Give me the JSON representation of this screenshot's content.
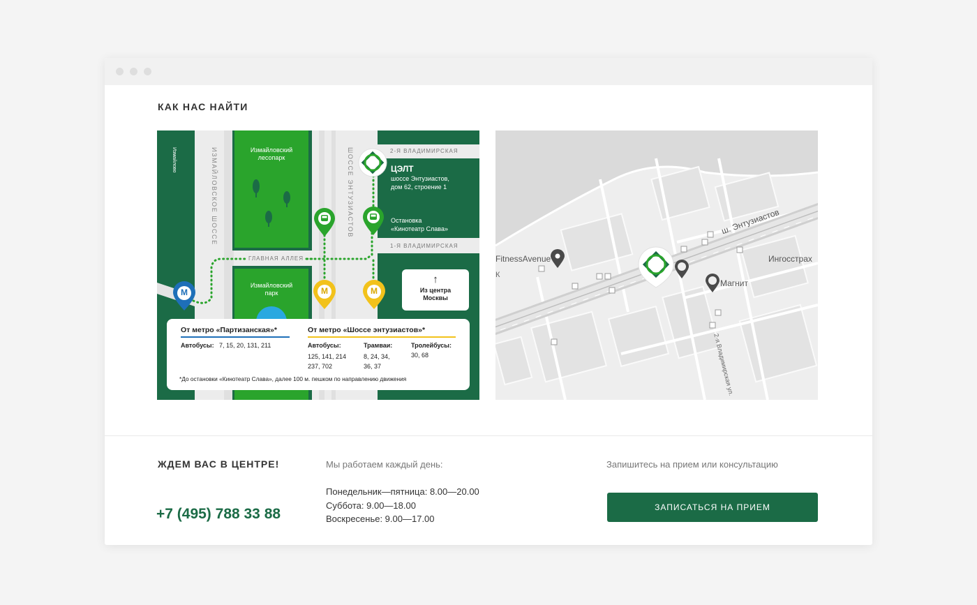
{
  "section": {
    "title": "КАК НАС НАЙТИ"
  },
  "scheme": {
    "street_izmailovo": "Измайлово",
    "street_izm_shosse": "ИЗМАЙЛОВСКОЕ ШОССЕ",
    "street_entuziastov": "ШОССЕ ЭНТУЗИАСТОВ",
    "street_vladimir2": "2-Я ВЛАДИМИРСКАЯ",
    "street_vladimir1": "1-Я ВЛАДИМИРСКАЯ",
    "street_main_alley": "ГЛАВНАЯ АЛЛЕЯ",
    "forest_park_1": "Измайловский",
    "forest_park_2": "лесопарк",
    "park_1": "Измайловский",
    "park_2": "парк",
    "center_name": "ЦЭЛТ",
    "center_addr_1": "шоссе Энтузиастов,",
    "center_addr_2": "дом 62, строение 1",
    "stop_1": "Остановка",
    "stop_2": "«Кинотеатр Слава»",
    "from_center_1": "Из центра",
    "from_center_2": "Москвы",
    "metro_glyph": "М",
    "arrow_glyph": "↑",
    "route1_title": "От метро «Партизанская»*",
    "route1_bus_label": "Автобусы:",
    "route1_bus_values": "7, 15, 20, 131, 211",
    "route2_title": "От метро «Шоссе энтузиастов»*",
    "route2_bus_label": "Автобусы:",
    "route2_bus_line1": "125, 141, 214",
    "route2_bus_line2": "237, 702",
    "route2_tram_label": "Трамваи:",
    "route2_tram_line1": "8, 24, 34,",
    "route2_tram_line2": "36, 37",
    "route2_trolley_label": "Тролейбусы:",
    "route2_trolley_values": "30, 68",
    "footnote": "*До остановки «Кинотеатр Слава», далее 100 м. пешком по направлению движения",
    "colors": {
      "dark_green": "#1b6b46",
      "grass": "#2aa42c",
      "metro_blue": "#1e6fb8",
      "metro_yellow": "#f2c21b"
    }
  },
  "gmap": {
    "label_fitness": "FitnessAvenue",
    "label_k": "К",
    "label_street": "ш. Энтузиастов",
    "label_ingos": "Ингосстрах",
    "label_magnit": "Магнит",
    "label_vlad": "2-я Владимирская ул."
  },
  "footer": {
    "title": "ЖДЕМ ВАС В ЦЕНТРЕ!",
    "phone": "+7 (495) 788 33 88",
    "hours_head": "Мы работаем каждый день:",
    "hours_weekdays": "Понедельник—пятница: 8.00—20.00",
    "hours_saturday": "Суббота: 9.00—18.00",
    "hours_sunday": "Воскресенье: 9.00—17.00",
    "cta_head": "Запишитесь на прием или консультацию",
    "cta_button": "ЗАПИСАТЬСЯ НА ПРИЕМ"
  }
}
